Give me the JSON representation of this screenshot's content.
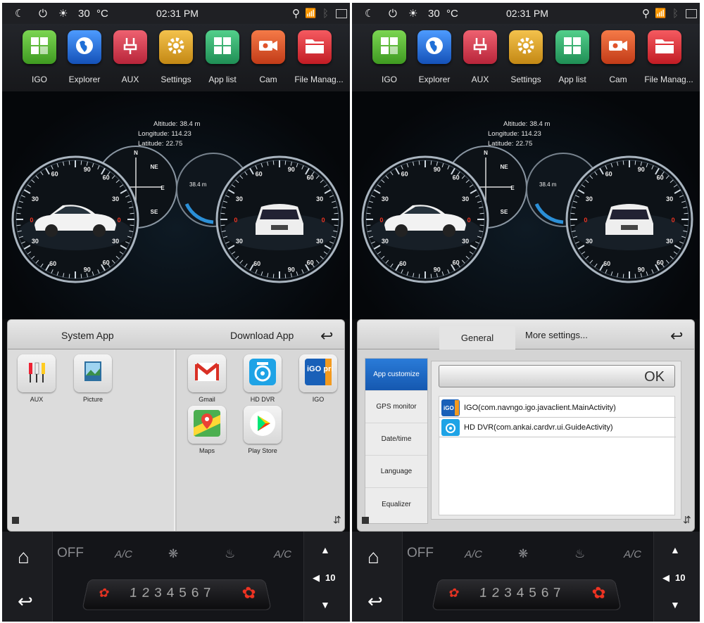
{
  "status": {
    "temperature": "30",
    "unit": "°C",
    "time": "02:31 PM"
  },
  "apps": [
    {
      "label": "IGO",
      "color": "#5fb33a",
      "icon": "app-grid-icon"
    },
    {
      "label": "Explorer",
      "color": "#1f6fd6",
      "icon": "globe-icon"
    },
    {
      "label": "AUX",
      "color": "#d53a4b",
      "icon": "aux-plug-icon"
    },
    {
      "label": "Settings",
      "color": "#d8a126",
      "icon": "gear-icon"
    },
    {
      "label": "App list",
      "color": "#2fa76a",
      "icon": "app-list-icon"
    },
    {
      "label": "Cam",
      "color": "#e0532a",
      "icon": "camera-icon"
    },
    {
      "label": "File Manag...",
      "color": "#e02f36",
      "icon": "folder-icon"
    }
  ],
  "gps": {
    "altitude_label": "Altitude:",
    "altitude": "38.4 m",
    "longitude_label": "Longitude:",
    "longitude": "114.23",
    "latitude_label": "Latitude:",
    "latitude": "22.75"
  },
  "gauges": {
    "speed_ticks": [
      "60",
      "90",
      "60",
      "30",
      "0",
      "30",
      "60",
      "90",
      "60",
      "30",
      "0",
      "30"
    ],
    "compass": [
      "N",
      "NE",
      "E",
      "SE"
    ],
    "altimeter": "38.4 m"
  },
  "left_panel": {
    "system_title": "System App",
    "download_title": "Download App",
    "system_apps": [
      {
        "label": "AUX",
        "icon": "aux-rca-icon"
      },
      {
        "label": "Picture",
        "icon": "picture-icon"
      }
    ],
    "download_apps": [
      {
        "label": "Gmail",
        "icon": "gmail-icon"
      },
      {
        "label": "HD DVR",
        "icon": "dvr-icon"
      },
      {
        "label": "IGO",
        "icon": "igo-primo-icon",
        "icon_text": "iGO primo"
      },
      {
        "label": "Maps",
        "icon": "maps-icon"
      },
      {
        "label": "Play Store",
        "icon": "play-store-icon"
      }
    ]
  },
  "right_panel": {
    "tabs": [
      "General",
      "More settings..."
    ],
    "sidebar": [
      "App customize",
      "GPS monitor",
      "Date/time",
      "Language",
      "Equalizer"
    ],
    "ok_label": "OK",
    "list": [
      {
        "text": "IGO(com.navngo.igo.javaclient.MainActivity)",
        "icon": "igo-primo-icon"
      },
      {
        "text": "HD DVR(com.ankai.cardvr.ui.GuideActivity)",
        "icon": "dvr-icon"
      }
    ]
  },
  "dock": {
    "off_label": "OFF",
    "ac_label": "A/C",
    "fan_levels": "1234567",
    "volume": "10"
  }
}
